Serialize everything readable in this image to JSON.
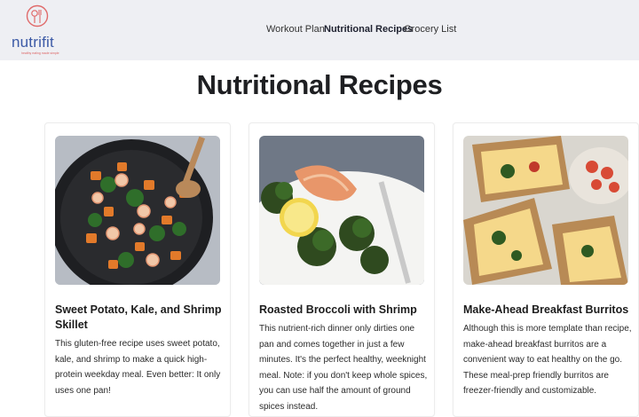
{
  "brand": {
    "name": "nutrifit",
    "tagline": "healthy eating made simple",
    "accent_color": "#3c5aa6",
    "mark_color": "#e06a6a"
  },
  "nav": {
    "links": [
      {
        "label": "Workout Plan",
        "active": false
      },
      {
        "label": "Nutritional Recipes",
        "active": true
      },
      {
        "label": "Grocery List",
        "active": false
      }
    ]
  },
  "page": {
    "title": "Nutritional Recipes"
  },
  "recipes": [
    {
      "title": "Sweet Potato, Kale, and Shrimp Skillet",
      "description": "This gluten-free recipe uses sweet potato, kale, and shrimp to make a quick high-protein weekday meal. Even better: It only uses one pan!",
      "image": "skillet-photo"
    },
    {
      "title": "Roasted Broccoli with Shrimp",
      "description": "This nutrient-rich dinner only dirties one pan and comes together in just a few minutes. It's the perfect healthy, weeknight meal. Note: if you don't keep whole spices, you can use half the amount of ground spices instead.",
      "image": "broccoli-shrimp-photo"
    },
    {
      "title": "Make-Ahead Breakfast Burritos",
      "description": "Although this is more template than recipe, make-ahead breakfast burritos are a convenient way to eat healthy on the go. These meal-prep friendly burritos are freezer-friendly and customizable.",
      "image": "burrito-photo"
    }
  ]
}
